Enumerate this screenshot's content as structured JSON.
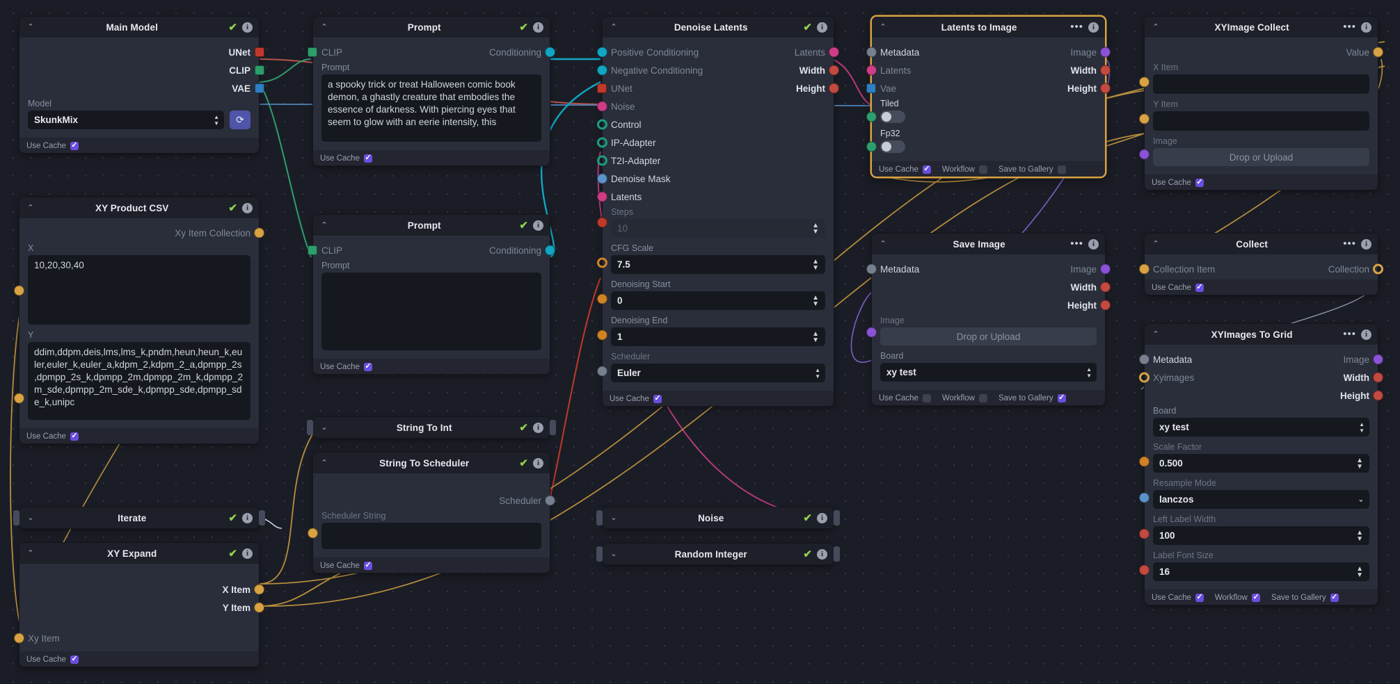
{
  "app": {
    "title": "Workflow Editor"
  },
  "nodes": {
    "main_model": {
      "title": "Main Model",
      "outputs": [
        {
          "label": "UNet"
        },
        {
          "label": "CLIP"
        },
        {
          "label": "VAE"
        }
      ],
      "model_label": "Model",
      "model_value": "SkunkMix",
      "refresh_icon": "refresh-icon",
      "footer": {
        "use_cache": "Use Cache",
        "use_cache_checked": true
      }
    },
    "xy_product_csv": {
      "title": "XY Product CSV",
      "output_label": "Xy Item Collection",
      "x_label": "X",
      "x_value": "10,20,30,40",
      "y_label": "Y",
      "y_value": "ddim,ddpm,deis,lms,lms_k,pndm,heun,heun_k,euler,euler_k,euler_a,kdpm_2,kdpm_2_a,dpmpp_2s,dpmpp_2s_k,dpmpp_2m,dpmpp_2m_k,dpmpp_2m_sde,dpmpp_2m_sde_k,dpmpp_sde,dpmpp_sde_k,unipc",
      "footer": {
        "use_cache": "Use Cache",
        "use_cache_checked": true
      }
    },
    "iterate": {
      "title": "Iterate"
    },
    "xy_expand": {
      "title": "XY Expand",
      "outputs": [
        {
          "label": "X Item"
        },
        {
          "label": "Y Item"
        }
      ],
      "input_label": "Xy Item",
      "footer": {
        "use_cache": "Use Cache",
        "use_cache_checked": true
      }
    },
    "prompt_positive": {
      "title": "Prompt",
      "clip_label": "CLIP",
      "conditioning_label": "Conditioning",
      "prompt_label": "Prompt",
      "prompt_value": "a spooky trick or treat Halloween comic book demon, a ghastly creature that embodies the essence of darkness. With piercing eyes that seem to glow with an eerie intensity, this",
      "footer": {
        "use_cache": "Use Cache",
        "use_cache_checked": true
      }
    },
    "prompt_negative": {
      "title": "Prompt",
      "clip_label": "CLIP",
      "conditioning_label": "Conditioning",
      "prompt_label": "Prompt",
      "prompt_value": "",
      "footer": {
        "use_cache": "Use Cache",
        "use_cache_checked": true
      }
    },
    "string_to_int": {
      "title": "String To Int"
    },
    "string_to_scheduler": {
      "title": "String To Scheduler",
      "output_label": "Scheduler",
      "input_label": "Scheduler String",
      "footer": {
        "use_cache": "Use Cache",
        "use_cache_checked": true
      }
    },
    "denoise_latents": {
      "title": "Denoise Latents",
      "inputs": [
        {
          "label": "Positive Conditioning"
        },
        {
          "label": "Negative Conditioning"
        },
        {
          "label": "UNet"
        },
        {
          "label": "Noise"
        },
        {
          "label": "Control"
        },
        {
          "label": "IP-Adapter"
        },
        {
          "label": "T2I-Adapter"
        },
        {
          "label": "Denoise Mask"
        },
        {
          "label": "Latents"
        }
      ],
      "outputs": [
        {
          "label": "Latents"
        },
        {
          "label": "Width"
        },
        {
          "label": "Height"
        }
      ],
      "fields": [
        {
          "label": "Steps",
          "value": "10",
          "dim": true
        },
        {
          "label": "CFG Scale",
          "value": "7.5",
          "dim": false
        },
        {
          "label": "Denoising Start",
          "value": "0",
          "dim": false
        },
        {
          "label": "Denoising End",
          "value": "1",
          "dim": false
        },
        {
          "label": "Scheduler",
          "value": "Euler",
          "dim": false
        }
      ],
      "footer": {
        "use_cache": "Use Cache",
        "use_cache_checked": true
      }
    },
    "noise": {
      "title": "Noise"
    },
    "random_integer": {
      "title": "Random Integer"
    },
    "latents_to_image": {
      "title": "Latents to Image",
      "inputs": [
        {
          "label": "Metadata"
        },
        {
          "label": "Latents"
        },
        {
          "label": "Vae"
        }
      ],
      "outputs": [
        {
          "label": "Image"
        },
        {
          "label": "Width"
        },
        {
          "label": "Height"
        }
      ],
      "tiled_label": "Tiled",
      "fp32_label": "Fp32",
      "footer": {
        "use_cache": "Use Cache",
        "use_cache_checked": true,
        "workflow": "Workflow",
        "workflow_checked": false,
        "save_to_gallery": "Save to Gallery",
        "save_checked": false
      }
    },
    "save_image": {
      "title": "Save Image",
      "inputs": [
        {
          "label": "Metadata"
        }
      ],
      "outputs": [
        {
          "label": "Image"
        },
        {
          "label": "Width"
        },
        {
          "label": "Height"
        }
      ],
      "image_label": "Image",
      "drop_label": "Drop or Upload",
      "board_label": "Board",
      "board_value": "xy test",
      "footer": {
        "use_cache": "Use Cache",
        "use_cache_checked": false,
        "workflow": "Workflow",
        "workflow_checked": false,
        "save_to_gallery": "Save to Gallery",
        "save_checked": true
      }
    },
    "xyimage_collect": {
      "title": "XYImage Collect",
      "output_label": "Value",
      "x_item_label": "X Item",
      "x_item_value": "",
      "y_item_label": "Y Item",
      "y_item_value": "",
      "image_label": "Image",
      "drop_label": "Drop or Upload",
      "footer": {
        "use_cache": "Use Cache",
        "use_cache_checked": true
      }
    },
    "collect": {
      "title": "Collect",
      "input_label": "Collection Item",
      "output_label": "Collection",
      "footer": {
        "use_cache": "Use Cache",
        "use_cache_checked": true
      }
    },
    "xyimages_to_grid": {
      "title": "XYImages To Grid",
      "inputs": [
        {
          "label": "Metadata"
        },
        {
          "label": "Xyimages"
        }
      ],
      "outputs": [
        {
          "label": "Image"
        },
        {
          "label": "Width"
        },
        {
          "label": "Height"
        }
      ],
      "fields": [
        {
          "label": "Board",
          "value": "xy test",
          "kind": "select"
        },
        {
          "label": "Scale Factor",
          "value": "0.500",
          "kind": "number"
        },
        {
          "label": "Resample Mode",
          "value": "lanczos",
          "kind": "dropdown"
        },
        {
          "label": "Left Label Width",
          "value": "100",
          "kind": "number"
        },
        {
          "label": "Label Font Size",
          "value": "16",
          "kind": "number"
        }
      ],
      "footer": {
        "use_cache": "Use Cache",
        "use_cache_checked": true,
        "workflow": "Workflow",
        "workflow_checked": true,
        "save_to_gallery": "Save to Gallery",
        "save_checked": true
      }
    }
  },
  "colors": {
    "accent": "#6b4ee0",
    "selected_node_border": "#d9a343",
    "check_green": "#8fd14f",
    "canvas_bg": "#1b1d26",
    "node_bg": "#2a2e3b",
    "header_bg": "#1e2029"
  }
}
